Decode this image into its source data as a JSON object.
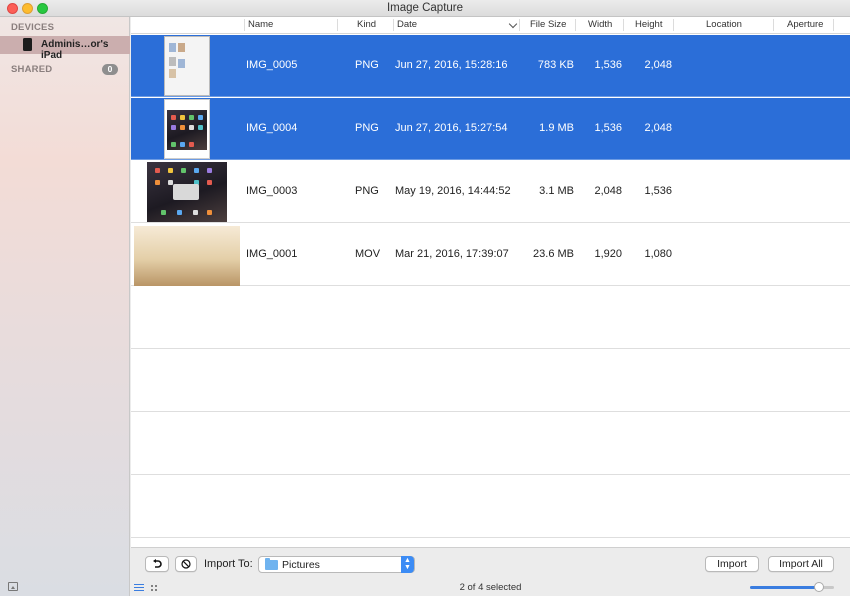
{
  "window": {
    "title": "Image Capture"
  },
  "sidebar": {
    "devices_heading": "DEVICES",
    "device_name": "Adminis…or's iPad",
    "shared_heading": "SHARED",
    "shared_count": "0"
  },
  "table": {
    "columns": [
      "Name",
      "Kind",
      "Date",
      "File Size",
      "Width",
      "Height",
      "Location",
      "Aperture"
    ],
    "sorted_column": "Date",
    "rows": [
      {
        "name": "IMG_0005",
        "kind": "PNG",
        "date": "Jun 27, 2016, 15:28:16",
        "size": "783 KB",
        "width": "1,536",
        "height": "2,048",
        "selected": true,
        "thumb": "ipad-screenshot-portrait"
      },
      {
        "name": "IMG_0004",
        "kind": "PNG",
        "date": "Jun 27, 2016, 15:27:54",
        "size": "1.9 MB",
        "width": "1,536",
        "height": "2,048",
        "selected": true,
        "thumb": "ipad-homescreen-portrait"
      },
      {
        "name": "IMG_0003",
        "kind": "PNG",
        "date": "May 19, 2016, 14:44:52",
        "size": "3.1 MB",
        "width": "2,048",
        "height": "1,536",
        "selected": false,
        "thumb": "ipad-homescreen-landscape"
      },
      {
        "name": "IMG_0001",
        "kind": "MOV",
        "date": "Mar 21, 2016, 17:39:07",
        "size": "23.6 MB",
        "width": "1,920",
        "height": "1,080",
        "selected": false,
        "thumb": "video-frame"
      }
    ]
  },
  "footer": {
    "rotate_icon": "rotate-left-icon",
    "delete_icon": "delete-prohibited-icon",
    "import_to_label": "Import To:",
    "destination": "Pictures",
    "import_label": "Import",
    "import_all_label": "Import All",
    "status": "2 of 4 selected",
    "thumbnail_size": 0.82
  },
  "colors": {
    "selection": "#2b6ed8",
    "accent": "#3c8cf5"
  }
}
